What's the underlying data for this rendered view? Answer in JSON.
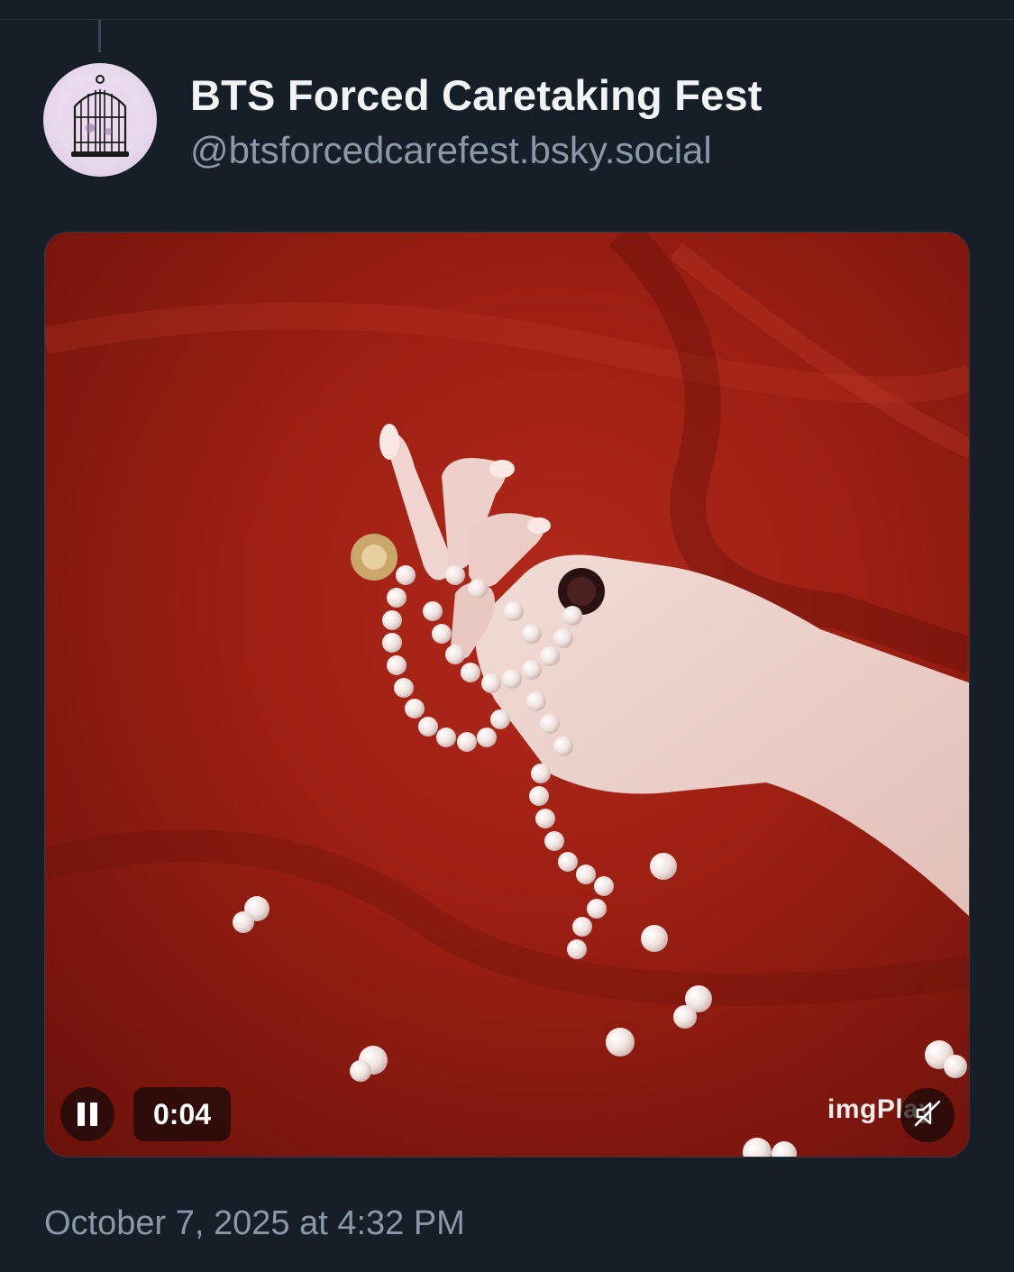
{
  "post": {
    "author": {
      "display_name": "BTS Forced Caretaking Fest",
      "handle": "@btsforcedcarefest.bsky.social",
      "avatar_icon": "birdcage-icon"
    },
    "video": {
      "elapsed_time": "0:04",
      "watermark": "imgPlay",
      "state": "playing",
      "muted": true,
      "controls": {
        "pause_icon": "pause-icon",
        "mute_icon": "muted-speaker-icon"
      }
    },
    "timestamp": "October 7, 2025 at 4:32 PM"
  },
  "colors": {
    "background": "#161e27",
    "name_text": "#f1f3f5",
    "secondary_text": "#8a98a8",
    "video_backdrop": "#8e1a0f"
  }
}
